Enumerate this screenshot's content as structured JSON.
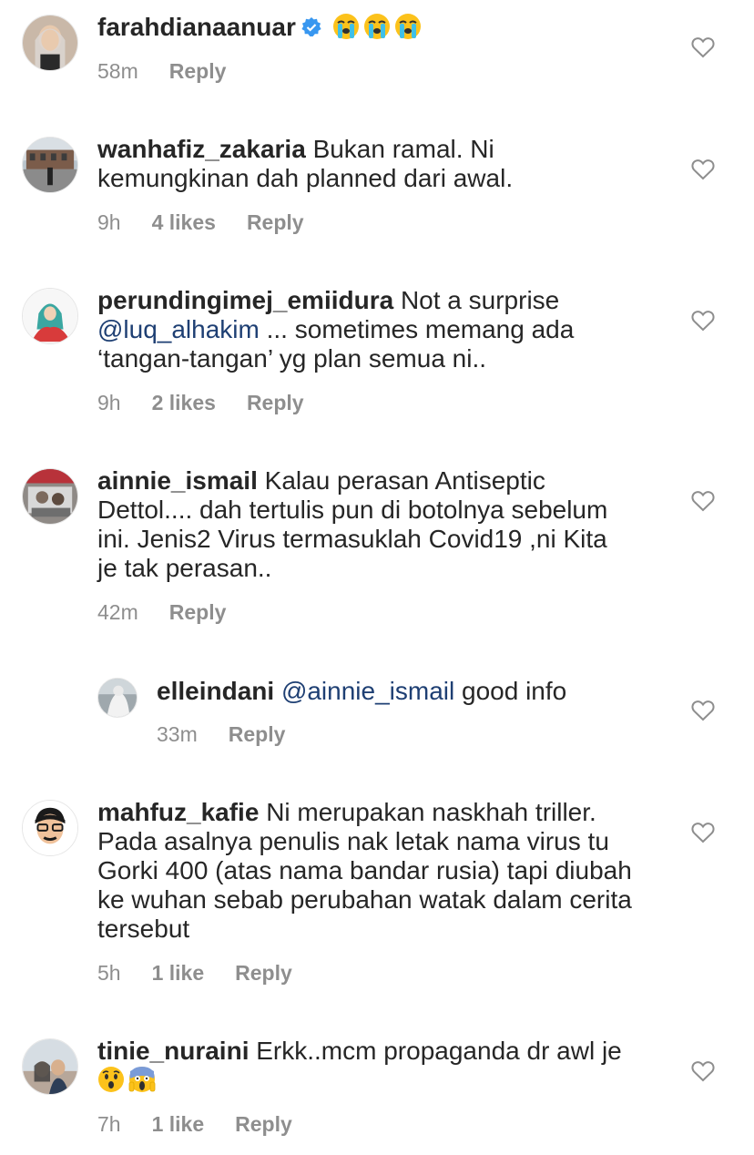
{
  "comments": [
    {
      "username": "farahdianaanuar",
      "verified": true,
      "text": "",
      "emojis": [
        "loudly-crying-face",
        "loudly-crying-face",
        "loudly-crying-face"
      ],
      "time": "58m",
      "likes": "",
      "reply_label": "Reply"
    },
    {
      "username": "wanhafiz_zakaria",
      "text_line1": "Bukan ramal. Ni",
      "text_line2": "kemungkinan dah planned dari awal.",
      "time": "9h",
      "likes": "4 likes",
      "reply_label": "Reply"
    },
    {
      "username": "perundingimej_emiidura",
      "text_line1": "Not a surprise",
      "mention": "@luq_alhakim",
      "text_line2": " ... sometimes memang ada",
      "text_line3": "‘tangan-tangan’ yg plan semua ni..",
      "time": "9h",
      "likes": "2 likes",
      "reply_label": "Reply"
    },
    {
      "username": "ainnie_ismail",
      "text_line1": "Kalau perasan Antiseptic",
      "text_line2": "Dettol.... dah tertulis pun di botolnya sebelum",
      "text_line3": "ini. Jenis2 Virus  termasuklah Covid19 ,ni Kita",
      "text_line4": "je tak perasan..",
      "time": "42m",
      "reply_label": "Reply"
    },
    {
      "username": "elleindani",
      "mention": "@ainnie_ismail",
      "text_line1": " good info",
      "time": "33m",
      "reply_label": "Reply"
    },
    {
      "username": "mahfuz_kafie",
      "text_line1": "Ni merupakan naskhah triller.",
      "text_line2": "Pada asalnya penulis nak letak nama virus tu",
      "text_line3": "Gorki 400 (atas nama bandar rusia) tapi diubah",
      "text_line4": "ke wuhan sebab perubahan watak dalam cerita",
      "text_line5": "tersebut",
      "time": "5h",
      "likes": "1 like",
      "reply_label": "Reply"
    },
    {
      "username": "tinie_nuraini",
      "text_line1": "Erkk..mcm propaganda dr awl je",
      "emojis": [
        "hushed-face",
        "face-screaming-in-fear"
      ],
      "time": "7h",
      "likes": "1 like",
      "reply_label": "Reply"
    }
  ],
  "colors": {
    "text": "#262626",
    "meta": "#8e8e8e",
    "mention": "#1e3f73",
    "verified": "#3897f0"
  }
}
